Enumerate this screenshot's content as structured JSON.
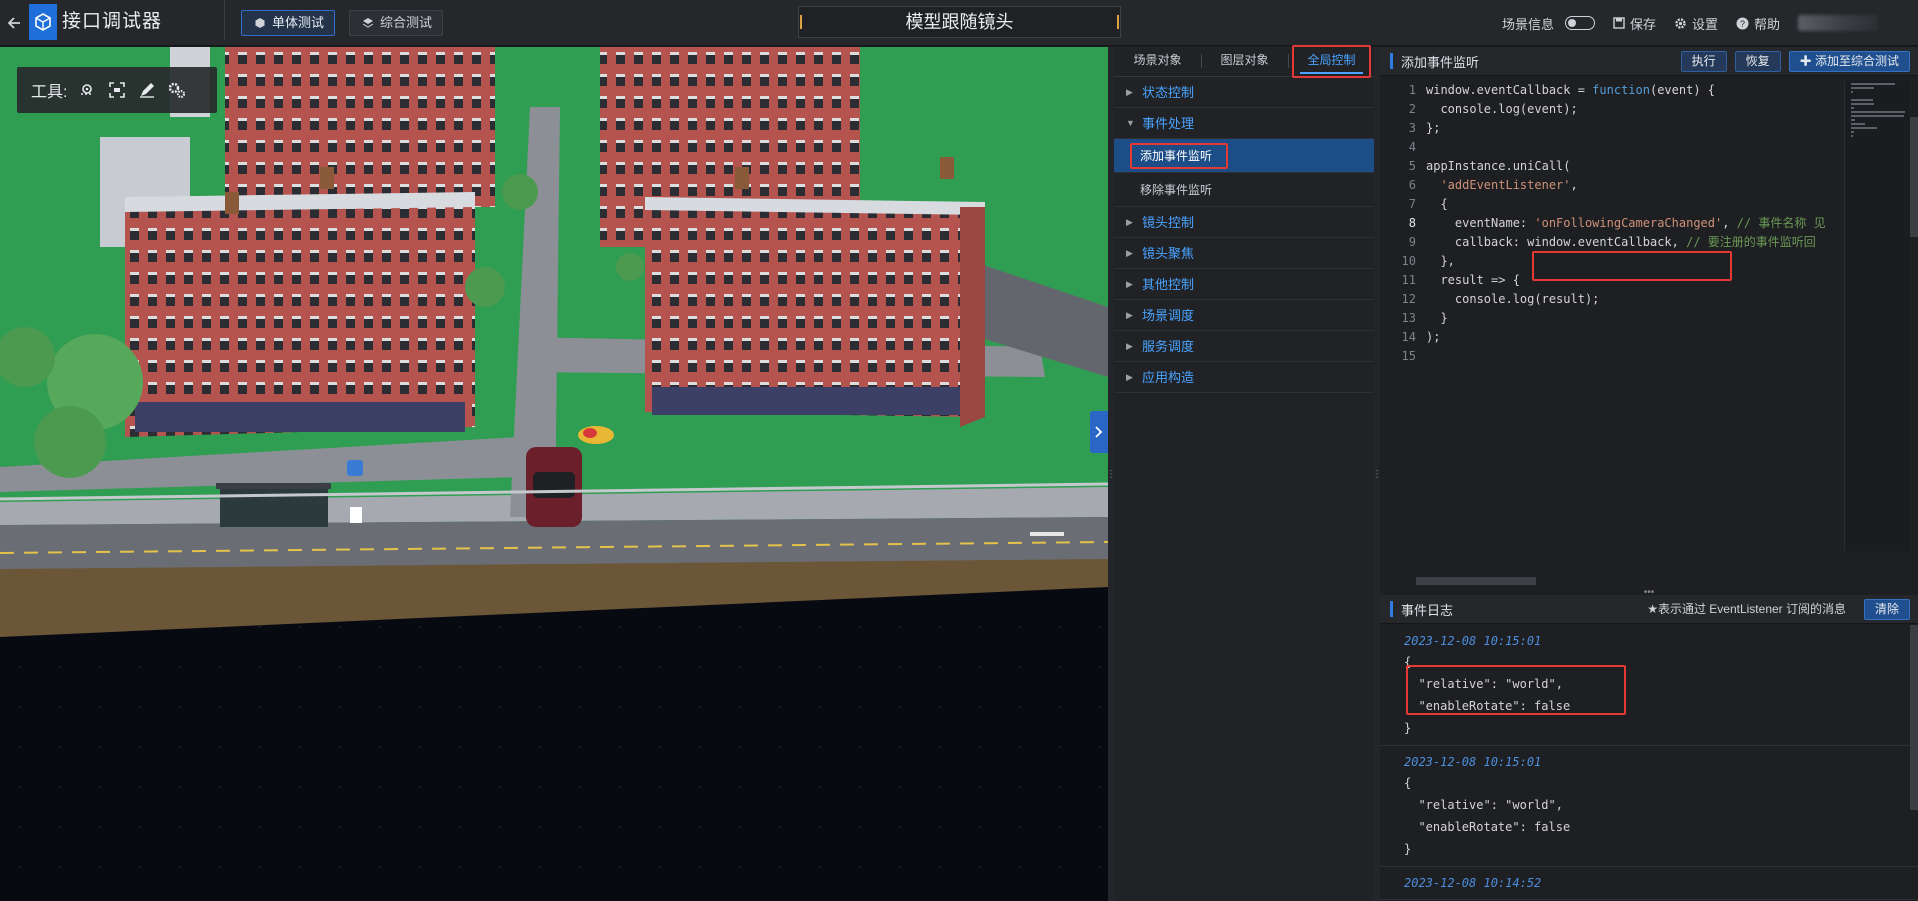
{
  "topbar": {
    "back_icon": "arrow-left-icon",
    "app_title": "接口调试器",
    "tabs": [
      {
        "label": "单体测试",
        "icon": "cube-icon",
        "active": true
      },
      {
        "label": "综合测试",
        "icon": "layers-icon",
        "active": false
      }
    ],
    "center_title": "模型跟随镜头",
    "scene_info_label": "场景信息",
    "save_label": "保存",
    "settings_label": "设置",
    "help_label": "帮助"
  },
  "viewport": {
    "tools_label": "工具:",
    "tool_icons": [
      "location-pin-icon",
      "focus-frame-icon",
      "pen-icon",
      "gears-icon"
    ]
  },
  "middle": {
    "tabs": [
      {
        "label": "场景对象",
        "active": false
      },
      {
        "label": "图层对象",
        "active": false
      },
      {
        "label": "全局控制",
        "active": true
      }
    ],
    "groups": [
      {
        "label": "状态控制",
        "expanded": false
      },
      {
        "label": "事件处理",
        "expanded": true,
        "items": [
          {
            "label": "添加事件监听",
            "selected": true
          },
          {
            "label": "移除事件监听",
            "selected": false
          }
        ]
      },
      {
        "label": "镜头控制",
        "expanded": false
      },
      {
        "label": "镜头聚焦",
        "expanded": false
      },
      {
        "label": "其他控制",
        "expanded": false
      },
      {
        "label": "场景调度",
        "expanded": false
      },
      {
        "label": "服务调度",
        "expanded": false
      },
      {
        "label": "应用构造",
        "expanded": false
      }
    ]
  },
  "editor": {
    "title": "添加事件监听",
    "run_label": "执行",
    "restore_label": "恢复",
    "add_label": "添加至综合测试",
    "current_line": 8,
    "lines": [
      "window.eventCallback = function(event) {",
      "  console.log(event);",
      "};",
      "",
      "appInstance.uniCall(",
      "  'addEventListener',",
      "  {",
      "    eventName: 'onFollowingCameraChanged', // 事件名称 见",
      "    callback: window.eventCallback, // 要注册的事件监听回",
      "  },",
      "  result => {",
      "    console.log(result);",
      "  }",
      ");",
      ""
    ]
  },
  "log": {
    "title": "事件日志",
    "hint": "★表示通过 EventListener 订阅的消息",
    "clear_label": "清除",
    "entries": [
      {
        "timestamp": "2023-12-08 10:15:01",
        "lines": [
          "{",
          "  \"relative\": \"world\",",
          "  \"enableRotate\": false",
          "}"
        ]
      },
      {
        "timestamp": "2023-12-08 10:15:01",
        "lines": [
          "{",
          "  \"relative\": \"world\",",
          "  \"enableRotate\": false",
          "}"
        ]
      },
      {
        "timestamp": "2023-12-08 10:14:52",
        "lines": []
      }
    ]
  },
  "colors": {
    "accent": "#2f7de0",
    "highlight_red": "#e53935",
    "selected_bg": "#1d4d86",
    "link_blue": "#4aa3ff"
  }
}
